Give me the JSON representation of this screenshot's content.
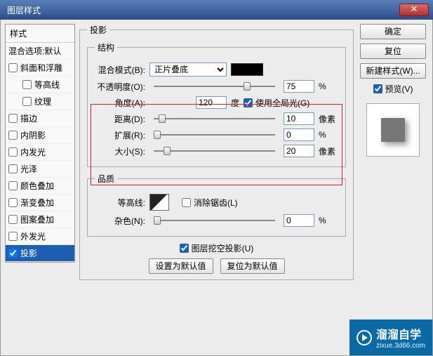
{
  "window": {
    "title": "图层样式"
  },
  "styles": {
    "header": "样式",
    "blend_defaults": "混合选项:默认",
    "items": [
      {
        "label": "斜面和浮雕",
        "checked": false
      },
      {
        "label": "等高线",
        "checked": false,
        "indent": true
      },
      {
        "label": "纹理",
        "checked": false,
        "indent": true
      },
      {
        "label": "描边",
        "checked": false
      },
      {
        "label": "内阴影",
        "checked": false
      },
      {
        "label": "内发光",
        "checked": false
      },
      {
        "label": "光泽",
        "checked": false
      },
      {
        "label": "颜色叠加",
        "checked": false
      },
      {
        "label": "渐变叠加",
        "checked": false
      },
      {
        "label": "图案叠加",
        "checked": false
      },
      {
        "label": "外发光",
        "checked": false
      },
      {
        "label": "投影",
        "checked": true,
        "active": true
      }
    ]
  },
  "main": {
    "section_title": "投影",
    "structure": {
      "legend": "结构",
      "blend_mode_label": "混合模式(B):",
      "blend_mode_value": "正片叠底",
      "opacity_label": "不透明度(O):",
      "opacity_value": "75",
      "opacity_unit": "%",
      "angle_label": "角度(A):",
      "angle_value": "120",
      "angle_unit": "度",
      "global_light_label": "使用全局光(G)",
      "global_light_checked": true,
      "distance_label": "距离(D):",
      "distance_value": "10",
      "distance_unit": "像素",
      "spread_label": "扩展(R):",
      "spread_value": "0",
      "spread_unit": "%",
      "size_label": "大小(S):",
      "size_value": "20",
      "size_unit": "像素"
    },
    "quality": {
      "legend": "品质",
      "contour_label": "等高线:",
      "antialias_label": "消除锯齿(L)",
      "antialias_checked": false,
      "noise_label": "杂色(N):",
      "noise_value": "0",
      "noise_unit": "%"
    },
    "knockout_label": "图层挖空投影(U)",
    "knockout_checked": true,
    "set_default": "设置为默认值",
    "reset_default": "复位为默认值"
  },
  "right": {
    "ok": "确定",
    "reset": "复位",
    "new_style": "新建样式(W)...",
    "preview_label": "预览(V)",
    "preview_checked": true
  },
  "watermark": {
    "brand": "溜溜自学",
    "url": "zixue.3d66.com"
  }
}
